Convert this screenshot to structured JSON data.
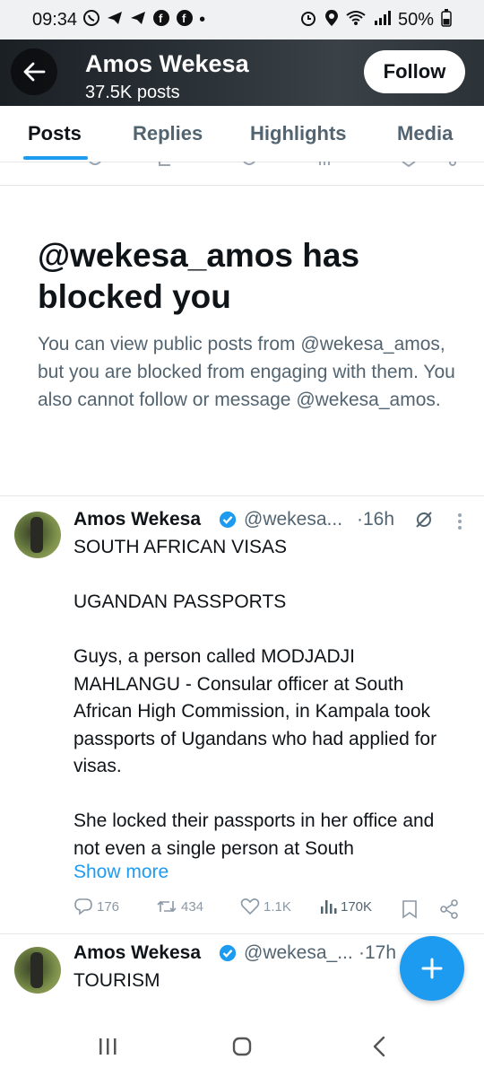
{
  "status_bar": {
    "time": "09:34",
    "battery": "50%",
    "dot": "•"
  },
  "header": {
    "name": "Amos Wekesa",
    "posts": "37.5K posts",
    "follow_label": "Follow"
  },
  "tabs": [
    {
      "label": "Posts",
      "active": true
    },
    {
      "label": "Replies",
      "active": false
    },
    {
      "label": "Highlights",
      "active": false
    },
    {
      "label": "Media",
      "active": false
    }
  ],
  "blocked": {
    "title": "@wekesa_amos has blocked you",
    "description": "You can view public posts from @wekesa_amos, but you are blocked from engaging with them. You also cannot follow or message @wekesa_amos."
  },
  "tweets": [
    {
      "name": "Amos Wekesa",
      "handle": "@wekesa...",
      "time": "·16h",
      "paragraphs": [
        "SOUTH AFRICAN VISAS",
        "UGANDAN PASSPORTS",
        "Guys, a person called MODJADJI MAHLANGU - Consular officer at South African High Commission, in Kampala took passports of Ugandans who had applied for visas.",
        "She locked their passports in her office and not even a single person at South"
      ],
      "show_more": "Show more",
      "replies": "176",
      "reposts": "434",
      "likes": "1.1K",
      "views": "170K"
    },
    {
      "name": "Amos Wekesa",
      "handle": "@wekesa_...",
      "time": "·17h",
      "paragraphs": [
        "TOURISM"
      ]
    }
  ],
  "colors": {
    "accent": "#1d9bf0",
    "text": "#0f1419",
    "muted": "#536471"
  },
  "icons": [
    "back-arrow-icon",
    "verified-badge-icon",
    "grok-icon",
    "more-icon",
    "reply-icon",
    "repost-icon",
    "like-icon",
    "views-icon",
    "bookmark-icon",
    "share-icon",
    "compose-plus-icon"
  ]
}
